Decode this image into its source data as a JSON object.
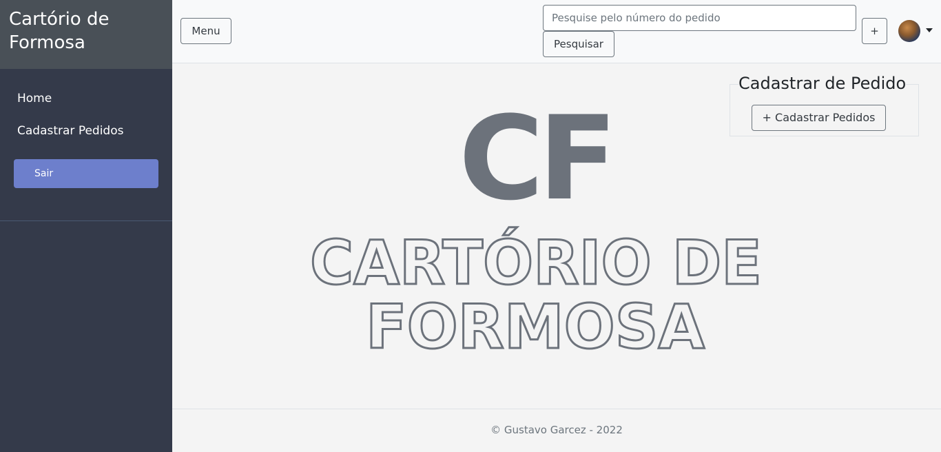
{
  "sidebar": {
    "brand": "Cartório de Formosa",
    "items": [
      {
        "label": "Home"
      },
      {
        "label": "Cadastrar Pedidos"
      }
    ],
    "logout_label": "Sair"
  },
  "topbar": {
    "menu_label": "Menu",
    "search": {
      "placeholder": "Pesquise pelo número do pedido",
      "value": ""
    },
    "search_button_label": "Pesquisar",
    "plus_label": "+"
  },
  "main": {
    "logo_letters": "CF",
    "logo_line1": "CARTÓRIO DE",
    "logo_line2": "FORMOSA",
    "register": {
      "title": "Cadastrar de Pedido",
      "button_label": "+ Cadastrar Pedidos"
    }
  },
  "footer": {
    "text": "© Gustavo Garcez - 2022"
  },
  "colors": {
    "sidebar_bg": "#343a4a",
    "brand_bg": "#495057",
    "accent": "#6d7fcc",
    "logo_gray": "#6c727b"
  }
}
